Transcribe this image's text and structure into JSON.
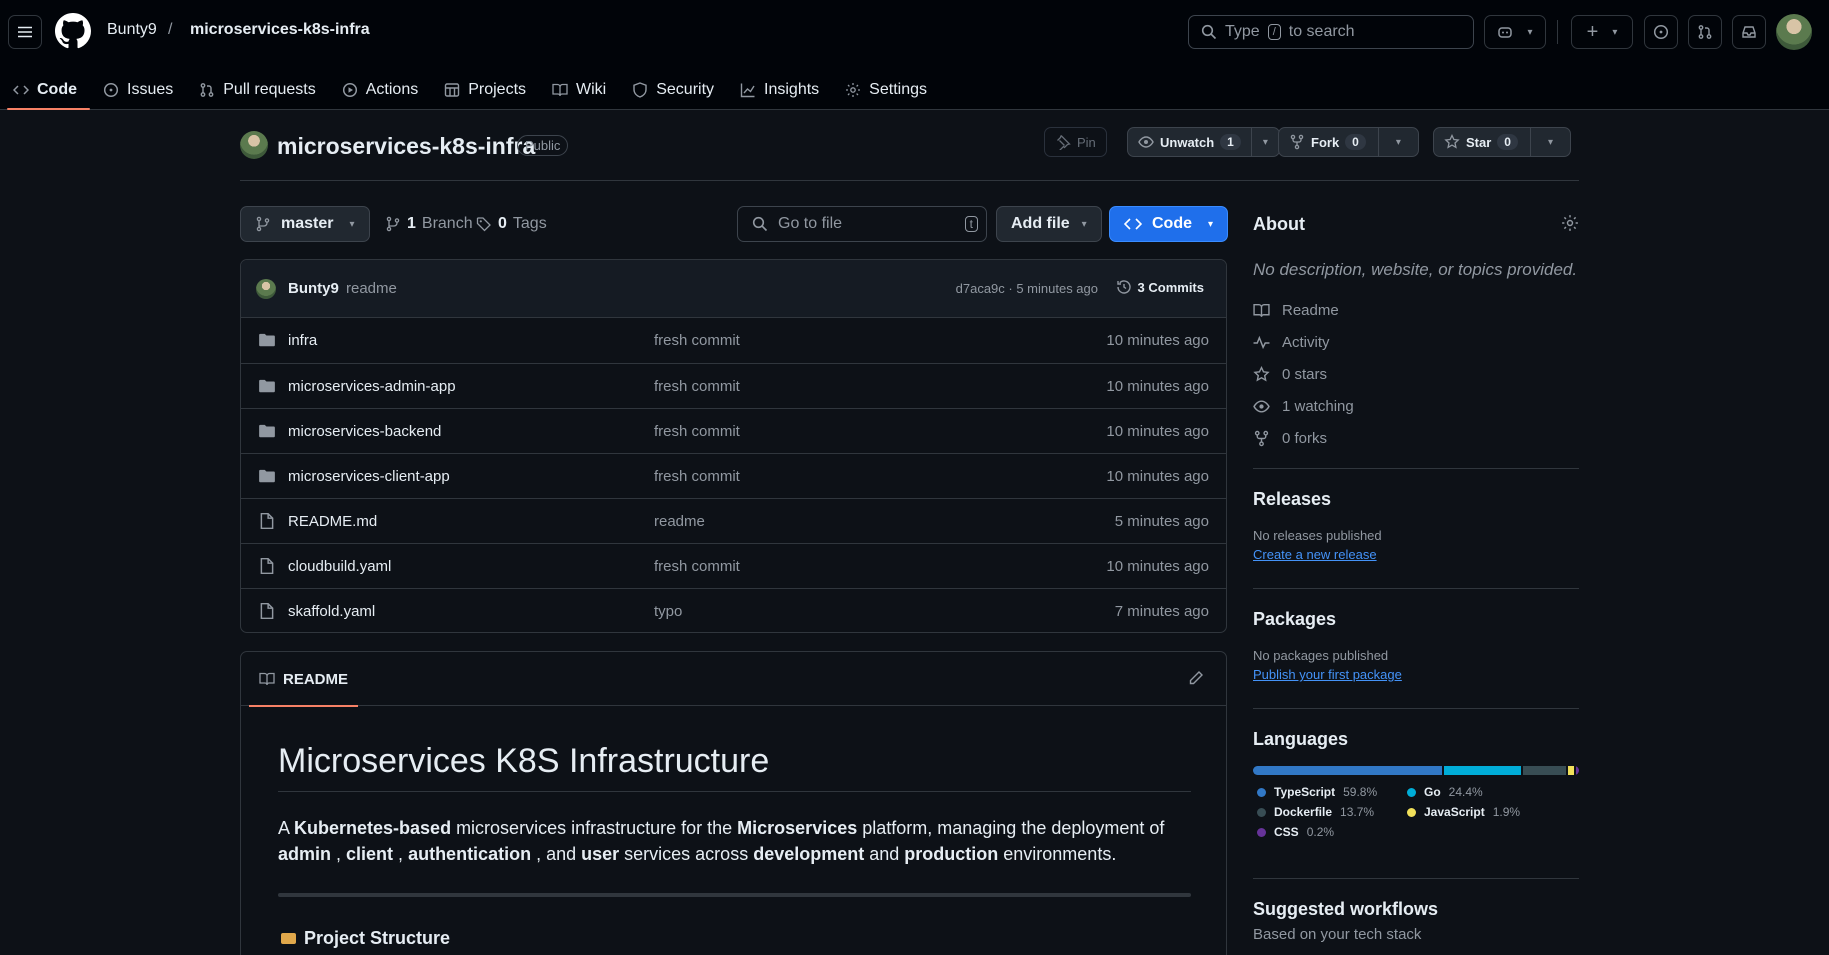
{
  "header": {
    "owner": "Bunty9",
    "separator": "/",
    "repo": "microservices-k8s-infra",
    "search_prefix": "Type",
    "search_key": "/",
    "search_suffix": "to search"
  },
  "tabs": [
    {
      "label": "Code",
      "icon": "code-icon",
      "active": true
    },
    {
      "label": "Issues",
      "icon": "issue-icon"
    },
    {
      "label": "Pull requests",
      "icon": "pull-request-icon"
    },
    {
      "label": "Actions",
      "icon": "play-icon"
    },
    {
      "label": "Projects",
      "icon": "table-icon"
    },
    {
      "label": "Wiki",
      "icon": "book-icon"
    },
    {
      "label": "Security",
      "icon": "shield-icon"
    },
    {
      "label": "Insights",
      "icon": "graph-icon"
    },
    {
      "label": "Settings",
      "icon": "gear-icon"
    }
  ],
  "repo": {
    "name": "microservices-k8s-infra",
    "visibility": "Public",
    "pin_label": "Pin",
    "watch_label": "Unwatch",
    "watch_count": "1",
    "fork_label": "Fork",
    "fork_count": "0",
    "star_label": "Star",
    "star_count": "0"
  },
  "toolbar": {
    "branch": "master",
    "branches_count": "1",
    "branches_label": "Branch",
    "tags_count": "0",
    "tags_label": "Tags",
    "goto_placeholder": "Go to file",
    "goto_key": "t",
    "add_file": "Add file",
    "code": "Code"
  },
  "last_commit": {
    "author": "Bunty9",
    "message": "readme",
    "sha_time": "d7aca9c · 5 minutes ago",
    "commits_label": "3 Commits"
  },
  "files": [
    {
      "name": "infra",
      "type": "dir",
      "message": "fresh commit",
      "time": "10 minutes ago"
    },
    {
      "name": "microservices-admin-app",
      "type": "dir",
      "message": "fresh commit",
      "time": "10 minutes ago"
    },
    {
      "name": "microservices-backend",
      "type": "dir",
      "message": "fresh commit",
      "time": "10 minutes ago"
    },
    {
      "name": "microservices-client-app",
      "type": "dir",
      "message": "fresh commit",
      "time": "10 minutes ago"
    },
    {
      "name": "README.md",
      "type": "file",
      "message": "readme",
      "time": "5 minutes ago"
    },
    {
      "name": "cloudbuild.yaml",
      "type": "file",
      "message": "fresh commit",
      "time": "10 minutes ago"
    },
    {
      "name": "skaffold.yaml",
      "type": "file",
      "message": "typo",
      "time": "7 minutes ago"
    }
  ],
  "readme": {
    "tab_label": "README",
    "title": "Microservices K8S Infrastructure",
    "lead_parts": [
      {
        "t": "A ",
        "b": false
      },
      {
        "t": "Kubernetes-based",
        "b": true
      },
      {
        "t": " microservices infrastructure for the ",
        "b": false
      },
      {
        "t": "Microservices",
        "b": true
      },
      {
        "t": " platform, managing the deployment of ",
        "b": false
      },
      {
        "t": "admin",
        "b": true
      },
      {
        "t": " , ",
        "b": false
      },
      {
        "t": "client",
        "b": true
      },
      {
        "t": " , ",
        "b": false
      },
      {
        "t": "authentication",
        "b": true
      },
      {
        "t": " , and ",
        "b": false
      },
      {
        "t": "user",
        "b": true
      },
      {
        "t": " services across ",
        "b": false
      },
      {
        "t": "development",
        "b": true
      },
      {
        "t": " and ",
        "b": false
      },
      {
        "t": "production",
        "b": true
      },
      {
        "t": " environments.",
        "b": false
      }
    ],
    "section": "Project Structure"
  },
  "about": {
    "title": "About",
    "description": "No description, website, or topics provided.",
    "items": [
      {
        "label": "Readme",
        "icon": "book-icon"
      },
      {
        "label": "Activity",
        "icon": "pulse-icon"
      },
      {
        "label": "0 stars",
        "icon": "star-icon"
      },
      {
        "label": "1 watching",
        "icon": "eye-icon"
      },
      {
        "label": "0 forks",
        "icon": "fork-icon"
      }
    ]
  },
  "releases": {
    "title": "Releases",
    "text": "No releases published",
    "link": "Create a new release"
  },
  "packages": {
    "title": "Packages",
    "text": "No packages published",
    "link": "Publish your first package"
  },
  "languages": {
    "title": "Languages",
    "items": [
      {
        "name": "TypeScript",
        "pct": "59.8%",
        "value": 59.8,
        "color": "#3178c6"
      },
      {
        "name": "Go",
        "pct": "24.4%",
        "value": 24.4,
        "color": "#00add8"
      },
      {
        "name": "Dockerfile",
        "pct": "13.7%",
        "value": 13.7,
        "color": "#384d54"
      },
      {
        "name": "JavaScript",
        "pct": "1.9%",
        "value": 1.9,
        "color": "#f1e05a"
      },
      {
        "name": "CSS",
        "pct": "0.2%",
        "value": 0.2,
        "color": "#663399"
      }
    ]
  },
  "workflows": {
    "title": "Suggested workflows",
    "subtitle": "Based on your tech stack"
  },
  "colors": {
    "accent": "#1f6feb",
    "tab_underline": "#f78166",
    "bg": "#0d1117"
  }
}
